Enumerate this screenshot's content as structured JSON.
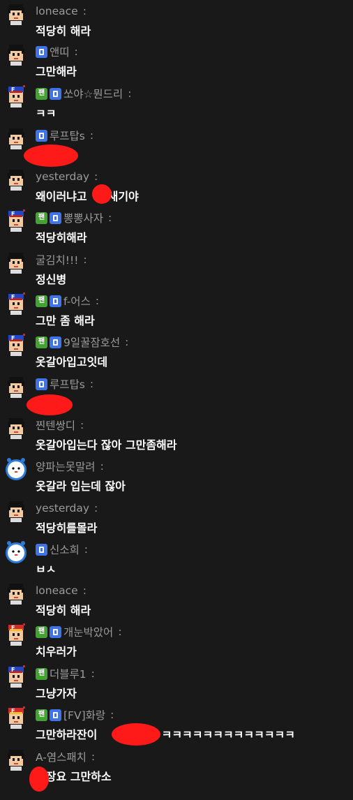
{
  "colors": {
    "background": "#191919",
    "nickname": "#9b9b9b",
    "message": "#ffffff",
    "fan_badge": "#43a232",
    "sub_badge": "#3f73e8",
    "redaction": "#ff1a1a"
  },
  "badge_labels": {
    "fan": "팬"
  },
  "messages": [
    {
      "avatar": "boy",
      "badges": [],
      "nick": "loneace",
      "text": "적당히 해라"
    },
    {
      "avatar": "boy",
      "badges": [
        "sub"
      ],
      "nick": "앤띠",
      "text": "그만해라"
    },
    {
      "avatar": "f-cap",
      "badges": [
        "fan",
        "sub"
      ],
      "nick": "쏘야☆뭔드리",
      "text": "ㅋㅋ"
    },
    {
      "avatar": "boy",
      "badges": [
        "sub"
      ],
      "nick": "루프탑s",
      "text": ""
    },
    {
      "avatar": "boy",
      "badges": [],
      "nick": "yesterday",
      "text": "왜이러냐고",
      "text2": "새기야"
    },
    {
      "avatar": "f-cap",
      "badges": [
        "fan",
        "sub"
      ],
      "nick": "뽕뽕사자",
      "text": "적당히해라"
    },
    {
      "avatar": "boy",
      "badges": [],
      "nick": "굴김치!!!",
      "text": "정신병"
    },
    {
      "avatar": "f-cap",
      "badges": [
        "fan",
        "sub"
      ],
      "nick": "f-어스",
      "text": "그만 좀 해라"
    },
    {
      "avatar": "f-cap",
      "badges": [
        "fan",
        "sub"
      ],
      "nick": "9일꿀잠호선",
      "text": "옷갈아입고잇데"
    },
    {
      "avatar": "boy",
      "badges": [
        "sub"
      ],
      "nick": "루프탑s",
      "text": ""
    },
    {
      "avatar": "boy",
      "badges": [],
      "nick": "찐텐쌍디",
      "text": "옷갈아입는다 잖아 그만좀해라"
    },
    {
      "avatar": "clock",
      "badges": [],
      "nick": "양파는못말려",
      "text": "옷갈라 입는데 잖아"
    },
    {
      "avatar": "boy",
      "badges": [],
      "nick": "yesterday",
      "text": "적당히를몰라"
    },
    {
      "avatar": "clock",
      "badges": [
        "sub"
      ],
      "nick": "신소희",
      "text": "ㅂㅅ"
    },
    {
      "avatar": "boy",
      "badges": [],
      "nick": "loneace",
      "text": "적당히 해라"
    },
    {
      "avatar": "f-cap-red",
      "badges": [
        "fan",
        "sub"
      ],
      "nick": "개눈박았어",
      "text": "치우러가"
    },
    {
      "avatar": "f-cap",
      "badges": [
        "fan"
      ],
      "nick": "더블루1",
      "text": "그냥가자"
    },
    {
      "avatar": "f-cap-red",
      "badges": [
        "fan",
        "sub"
      ],
      "nick": "[FV]화랑",
      "text": "그만하라잔이",
      "text2": "아 ㅋㅋㅋㅋㅋㅋㅋㅋㅋㅋㅋㅋㅋ"
    },
    {
      "avatar": "boy",
      "badges": [],
      "nick": "A-염스패치",
      "text": "사장요 그만하소"
    }
  ]
}
